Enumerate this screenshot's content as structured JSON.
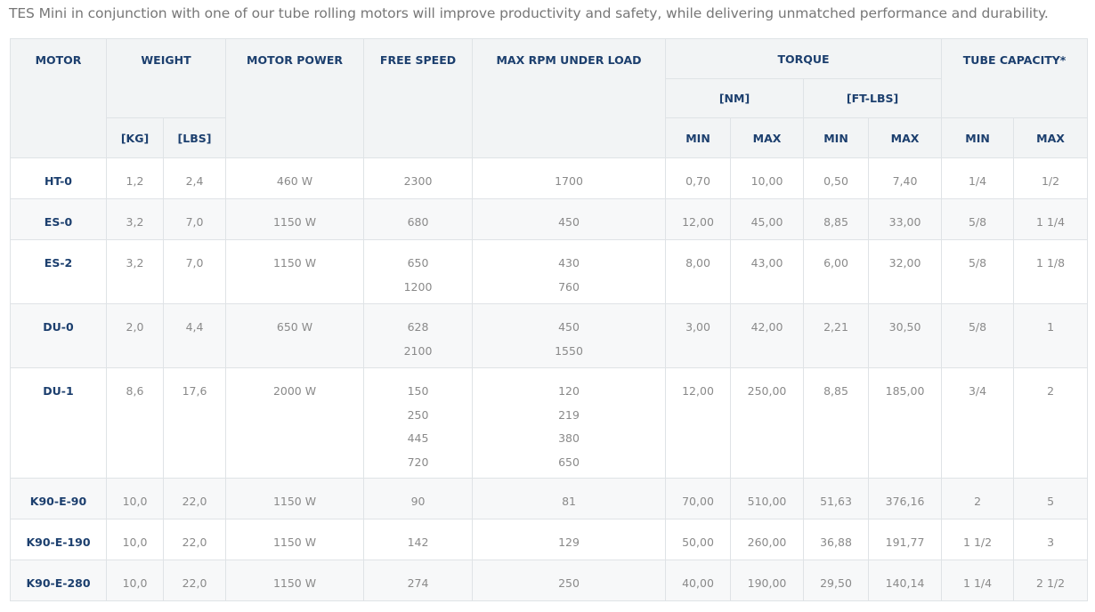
{
  "intro": "TES Mini in conjunction with one of our tube rolling motors will improve productivity and safety, while delivering unmatched performance and durability.",
  "headers": {
    "motor": "MOTOR",
    "weight": "WEIGHT",
    "motor_power": "MOTOR POWER",
    "free_speed": "FREE SPEED",
    "max_rpm": "MAX RPM UNDER LOAD",
    "torque": "TORQUE",
    "tube_capacity": "TUBE CAPACITY*",
    "kg": "[KG]",
    "lbs": "[LBS]",
    "nm": "[NM]",
    "ftlbs": "[FT-LBS]",
    "min": "MIN",
    "max": "MAX"
  },
  "rows": [
    {
      "motor": "HT-0",
      "kg": "1,2",
      "lbs": "2,4",
      "power": "460 W",
      "free_speed": [
        "2300"
      ],
      "max_rpm": [
        "1700"
      ],
      "nm_min": "0,70",
      "nm_max": "10,00",
      "ft_min": "0,50",
      "ft_max": "7,40",
      "tube_min": "1/4",
      "tube_max": "1/2"
    },
    {
      "motor": "ES-0",
      "kg": "3,2",
      "lbs": "7,0",
      "power": "1150 W",
      "free_speed": [
        "680"
      ],
      "max_rpm": [
        "450"
      ],
      "nm_min": "12,00",
      "nm_max": "45,00",
      "ft_min": "8,85",
      "ft_max": "33,00",
      "tube_min": "5/8",
      "tube_max": "1 1/4"
    },
    {
      "motor": "ES-2",
      "kg": "3,2",
      "lbs": "7,0",
      "power": "1150 W",
      "free_speed": [
        "650",
        "1200"
      ],
      "max_rpm": [
        "430",
        "760"
      ],
      "nm_min": "8,00",
      "nm_max": "43,00",
      "ft_min": "6,00",
      "ft_max": "32,00",
      "tube_min": "5/8",
      "tube_max": "1 1/8"
    },
    {
      "motor": "DU-0",
      "kg": "2,0",
      "lbs": "4,4",
      "power": "650 W",
      "free_speed": [
        "628",
        "2100"
      ],
      "max_rpm": [
        "450",
        "1550"
      ],
      "nm_min": "3,00",
      "nm_max": "42,00",
      "ft_min": "2,21",
      "ft_max": "30,50",
      "tube_min": "5/8",
      "tube_max": "1"
    },
    {
      "motor": "DU-1",
      "kg": "8,6",
      "lbs": "17,6",
      "power": "2000 W",
      "free_speed": [
        "150",
        "250",
        "445",
        "720"
      ],
      "max_rpm": [
        "120",
        "219",
        "380",
        "650"
      ],
      "nm_min": "12,00",
      "nm_max": "250,00",
      "ft_min": "8,85",
      "ft_max": "185,00",
      "tube_min": "3/4",
      "tube_max": "2"
    },
    {
      "motor": "K90-E-90",
      "kg": "10,0",
      "lbs": "22,0",
      "power": "1150 W",
      "free_speed": [
        "90"
      ],
      "max_rpm": [
        "81"
      ],
      "nm_min": "70,00",
      "nm_max": "510,00",
      "ft_min": "51,63",
      "ft_max": "376,16",
      "tube_min": "2",
      "tube_max": "5"
    },
    {
      "motor": "K90-E-190",
      "kg": "10,0",
      "lbs": "22,0",
      "power": "1150 W",
      "free_speed": [
        "142"
      ],
      "max_rpm": [
        "129"
      ],
      "nm_min": "50,00",
      "nm_max": "260,00",
      "ft_min": "36,88",
      "ft_max": "191,77",
      "tube_min": "1 1/2",
      "tube_max": "3"
    },
    {
      "motor": "K90-E-280",
      "kg": "10,0",
      "lbs": "22,0",
      "power": "1150 W",
      "free_speed": [
        "274"
      ],
      "max_rpm": [
        "250"
      ],
      "nm_min": "40,00",
      "nm_max": "190,00",
      "ft_min": "29,50",
      "ft_max": "140,14",
      "tube_min": "1 1/4",
      "tube_max": "2 1/2"
    }
  ]
}
